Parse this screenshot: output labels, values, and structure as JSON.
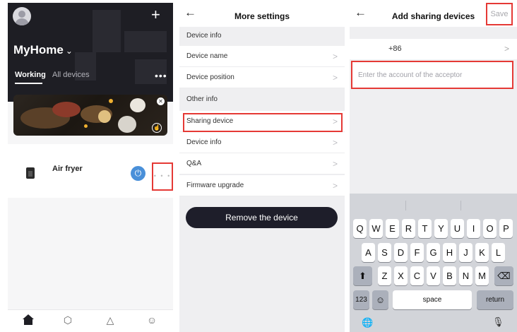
{
  "panel1": {
    "plus_icon": "plus-icon",
    "home_name": "MyHome",
    "home_chevron": "⌄",
    "tabs": [
      {
        "label": "Working"
      },
      {
        "label": "All devices"
      }
    ],
    "more_dots": "•••",
    "banner_close": "✕",
    "device": {
      "name": "Air fryer"
    },
    "more_button_dots": "• • •",
    "tabbar_icons": [
      "home-icon",
      "cube-icon",
      "bell-icon",
      "smiley-icon"
    ]
  },
  "panel2": {
    "back": "←",
    "title": "More settings",
    "section_device_info": "Device info",
    "rows_a": [
      "Device name",
      "Device position"
    ],
    "section_other_info": "Other info",
    "rows_b": [
      "Sharing device",
      "Device info",
      "Q&A",
      "Firmware upgrade"
    ],
    "arrow": ">",
    "remove_label": "Remove the device"
  },
  "panel3": {
    "back": "←",
    "title": "Add sharing devices",
    "save_label": "Save",
    "country_code": "+86",
    "arrow": ">",
    "account_placeholder": "Enter the account of the acceptor",
    "keyboard": {
      "row1": [
        "Q",
        "W",
        "E",
        "R",
        "T",
        "Y",
        "U",
        "I",
        "O",
        "P"
      ],
      "row2": [
        "A",
        "S",
        "D",
        "F",
        "G",
        "H",
        "J",
        "K",
        "L"
      ],
      "row3": [
        "Z",
        "X",
        "C",
        "V",
        "B",
        "N",
        "M"
      ],
      "shift": "⬆",
      "backspace": "⌫",
      "numbers": "123",
      "emoji": "☺",
      "space": "space",
      "return": "return",
      "globe": "🌐",
      "mic": "🎙"
    }
  },
  "colors": {
    "highlight": "#e53935",
    "dark": "#1e1e24",
    "power": "#4a90d9"
  }
}
